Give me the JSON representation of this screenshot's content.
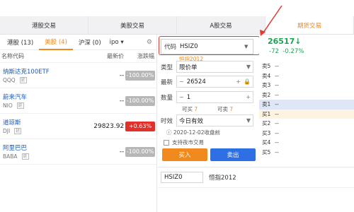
{
  "top_tabs": [
    {
      "label": "港股交易",
      "active": false
    },
    {
      "label": "美股交易",
      "active": false
    },
    {
      "label": "A股交易",
      "active": false
    },
    {
      "label": "期货交易",
      "active": true
    }
  ],
  "sub_tabs": [
    "港股 (13)",
    "美股 (4)",
    "沪深 (0)",
    "ipo"
  ],
  "columns": {
    "name": "名称代码",
    "price": "最新价",
    "change": "涨跌幅"
  },
  "watchlist": [
    {
      "name": "纳斯达克100ETF",
      "code": "QQQ",
      "tag": "延",
      "price": "--",
      "change": "-100.00%",
      "change_color": "#b7b7b7"
    },
    {
      "name": "蔚来汽车",
      "code": "NIO",
      "tag": "延",
      "price": "--",
      "change": "-100.00%",
      "change_color": "#b7b7b7"
    },
    {
      "name": "道琼斯",
      "code": "DJI",
      "tag": "延",
      "price": "29823.92",
      "change": "+0.63%",
      "change_color": "#e0322b"
    },
    {
      "name": "阿里巴巴",
      "code": "BABA",
      "tag": "延",
      "price": "--",
      "change": "-100.00%",
      "change_color": "#b7b7b7"
    }
  ],
  "order": {
    "code_label": "代码",
    "code_value": "HSIZ0",
    "code_name": "恒指2012",
    "type_label": "类型",
    "type_value": "限价单",
    "price_label": "最新",
    "price_value": "26524",
    "qty_label": "数量",
    "qty_value": "1",
    "can_buy_label": "可买",
    "can_buy": "7",
    "can_sell_label": "可卖",
    "can_sell": "7",
    "tif_label": "时效",
    "tif_value": "今日有效",
    "expiry_note": "2020-12-02收盘前",
    "night_label": "支持夜市交易",
    "buy_label": "买入",
    "sell_label": "卖出"
  },
  "quote": {
    "price": "26517",
    "arrow": "↓",
    "change": "-72",
    "change_pct": "-0.27%",
    "rows": [
      {
        "label": "卖5",
        "value": "--"
      },
      {
        "label": "卖4",
        "value": "--"
      },
      {
        "label": "卖3",
        "value": "--"
      },
      {
        "label": "卖2",
        "value": "--"
      },
      {
        "label": "卖1",
        "value": "--"
      },
      {
        "label": "买1",
        "value": "--"
      },
      {
        "label": "买2",
        "value": "--"
      },
      {
        "label": "买3",
        "value": "--"
      },
      {
        "label": "买4",
        "value": "--"
      },
      {
        "label": "买5",
        "value": "--"
      }
    ]
  },
  "lower": {
    "code": "HSIZ0",
    "name": "恒指2012"
  },
  "colors": {
    "accent": "#f08a1e",
    "buy": "#f08a1e",
    "sell": "#2f6fe4",
    "down": "#1aa352",
    "annotation": "#e23b2f"
  }
}
